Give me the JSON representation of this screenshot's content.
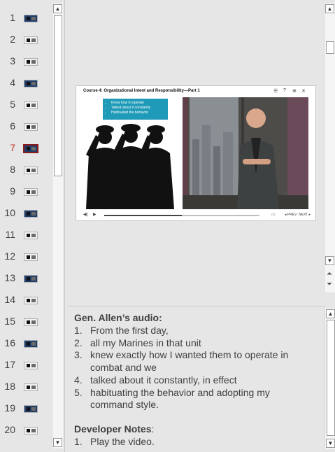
{
  "thumbnails": [
    {
      "num": "1"
    },
    {
      "num": "2"
    },
    {
      "num": "3"
    },
    {
      "num": "4"
    },
    {
      "num": "5"
    },
    {
      "num": "6"
    },
    {
      "num": "7",
      "active": true
    },
    {
      "num": "8"
    },
    {
      "num": "9"
    },
    {
      "num": "10"
    },
    {
      "num": "11"
    },
    {
      "num": "12"
    },
    {
      "num": "13"
    },
    {
      "num": "14"
    },
    {
      "num": "15"
    },
    {
      "num": "16"
    },
    {
      "num": "17"
    },
    {
      "num": "18"
    },
    {
      "num": "19"
    },
    {
      "num": "20"
    }
  ],
  "slide": {
    "title": "Course 4: Organizational Intent and Responsibility—Part 1",
    "bullets": [
      "Knew how to operate",
      "Talked about it constantly",
      "Habituated the behavior"
    ],
    "video_progress": 0.5
  },
  "notes": {
    "audio_heading": "Gen. Allen’s audio:",
    "audio_lines": [
      {
        "n": "1.",
        "text": "From the first day,"
      },
      {
        "n": "2.",
        "text": "all my Marines in that unit"
      },
      {
        "n": "3.",
        "text": "knew exactly how I wanted them to operate in"
      },
      {
        "n": "",
        "text": "combat and we"
      },
      {
        "n": "4.",
        "text": "talked about it constantly, in effect"
      },
      {
        "n": "5.",
        "text": "habituating the behavior and adopting my"
      },
      {
        "n": "",
        "text": "command style."
      }
    ],
    "dev_heading": "Developer Notes",
    "dev_colon": ":",
    "dev_lines": [
      {
        "n": "1.",
        "text": "Play the video."
      }
    ]
  },
  "colors": {
    "accent_active": "#8b1a1a",
    "bubble": "#1f9ab8"
  }
}
